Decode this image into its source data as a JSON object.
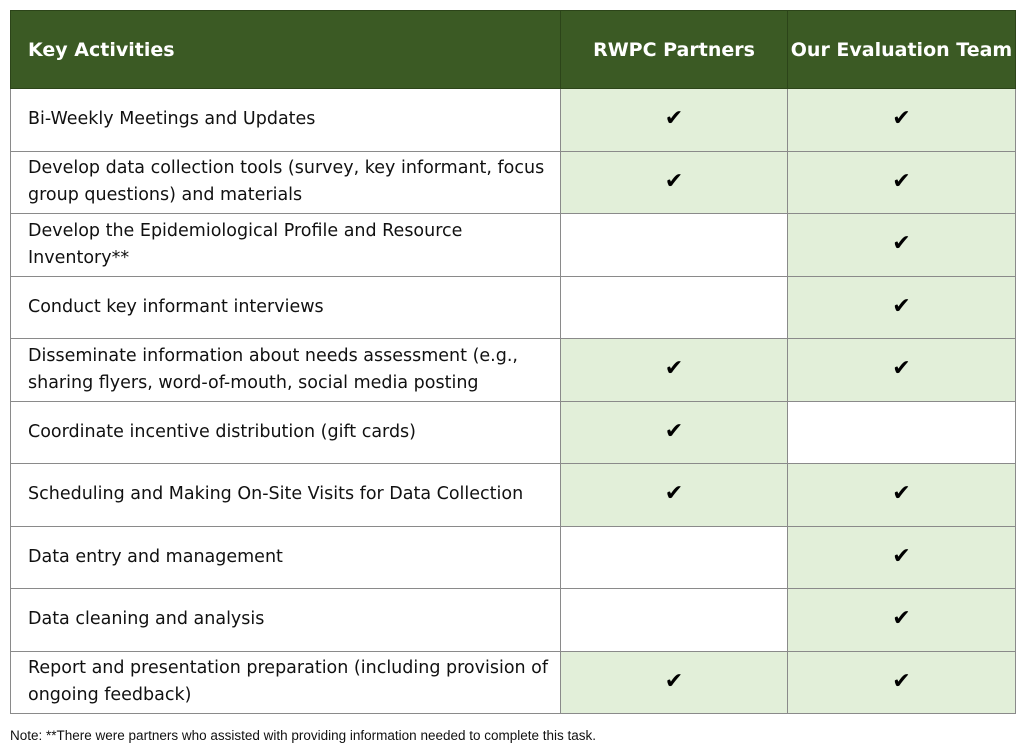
{
  "table": {
    "headers": [
      "Key Activities",
      "RWPC Partners",
      "Our Evaluation Team"
    ],
    "rows": [
      {
        "activity": "Bi-Weekly Meetings and Updates",
        "rwpc": true,
        "team": true
      },
      {
        "activity": "Develop data collection tools (survey, key informant, focus group questions) and materials",
        "rwpc": true,
        "team": true
      },
      {
        "activity": "Develop the Epidemiological Profile and Resource Inventory**",
        "rwpc": false,
        "team": true
      },
      {
        "activity": "Conduct key informant interviews",
        "rwpc": false,
        "team": true
      },
      {
        "activity": "Disseminate information about needs assessment (e.g., sharing flyers, word-of-mouth, social media posting",
        "rwpc": true,
        "team": true
      },
      {
        "activity": "Coordinate incentive distribution (gift cards)",
        "rwpc": true,
        "team": false
      },
      {
        "activity": "Scheduling and Making On-Site Visits for Data Collection",
        "rwpc": true,
        "team": true
      },
      {
        "activity": "Data entry and management",
        "rwpc": false,
        "team": true
      },
      {
        "activity": "Data cleaning and analysis",
        "rwpc": false,
        "team": true
      },
      {
        "activity": "Report and presentation preparation (including provision of ongoing feedback)",
        "rwpc": true,
        "team": true
      }
    ],
    "check_icon": "✔"
  },
  "note": "Note: **There were partners who assisted with providing information needed to complete this task.",
  "colors": {
    "header_bg": "#3b5a24",
    "checked_bg": "#e2efd9"
  }
}
